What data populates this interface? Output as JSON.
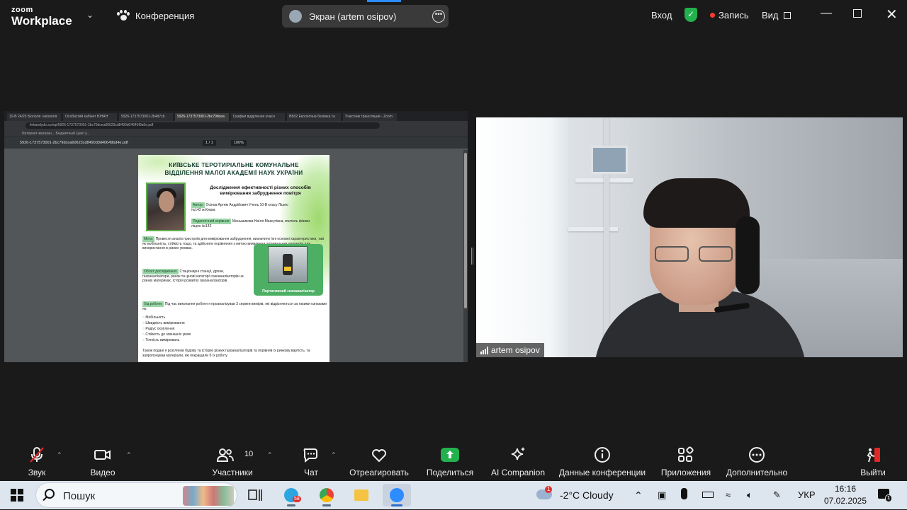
{
  "app": {
    "brand_line1": "zoom",
    "brand_line2": "Workplace",
    "conference_label": "Конференция",
    "screen_share_label": "Экран (artem osipov)",
    "signin_label": "Вход",
    "record_label": "Запись",
    "view_label": "Вид"
  },
  "shared_screen": {
    "tabs": [
      "10-В 24/25 Біологія і екологія",
      "Особистий кабінет ЮНАН",
      "5926-1737573001-2b4d7cb",
      "5926-1737573001-2bc79dcea",
      "Графіки відділення учасн",
      "ВБ02 Екологічна безпека та",
      "Участник трансляции - Zoom"
    ],
    "url": "liekandydo.su/wp/5926-1737573001-2bc79dcea60623cd8490d04640f9a6e.pdf",
    "bookmarks": "Интернет-магазин...   Бюджетный Цикл у...",
    "pdf_name": "5926-1737573001-2bc79dcea60623cd8490d0d40649bd4e.pdf",
    "page_indicator": "1 / 1",
    "zoom_level": "100%",
    "poster": {
      "title_line1": "КИЇВСЬКЕ ТЕРОТИРІАЛЬНЕ КОМУНАЛЬНЕ",
      "title_line2": "ВІДДІЛЕННЯ МАЛОЇ АКАДЕМІЇ НАУК УКРАЇНИ",
      "subtitle": "Дослідження ефективності різних способів вимірювання забруднення повітря",
      "author_tag": "Автор:",
      "author_text": "Осіпов Артем Андрійович Учень 10-В класу Ліцею №142 м.Києва",
      "advisor_tag": "Педагогічний керівник:",
      "advisor_text": "Меньшикова Наїля Максутівна, вчитель фізики ліцею №142",
      "goal_tag": "Мета:",
      "goal_text": "Провести аналіз пристроїв для вимірювання забруднення, визначити їхні основні характеристики, такі як мобільність, стійкість тощо, та здійснити порівняння з метою виявлення оптимальних варіантів для використання в різних умовах.",
      "object_tag": "Об'єкт дослідження:",
      "object_text": "Стаціонарні станції, дрони, газоаналізатори, ринок та ціновї категорії газоаналізаторів на різних материках, історія розвитку газоаналізаторів.",
      "gas_caption": "Портативний газоаналізатор",
      "process_tag": "Хід роботи:",
      "process_text": "Під час виконання роботи я проаналізував 3 сервеи вимірів, які відрізняються за такими ознаками як:",
      "list": [
        "Мобільність",
        "Швидкість вимірювання",
        "Радіус охоплення",
        "Стійкість до зовнішніх умов",
        "Точність вимірювань"
      ],
      "footer_text": "Також подані я розглянув будову та історію різних газоаналізаторів та порівняв їх ринкову вартість, та запропонував матеріали, які покращили б їх роботу"
    }
  },
  "video": {
    "participant_name": "artem osipov"
  },
  "toolbar": {
    "audio": "Звук",
    "video": "Видео",
    "participants": "Участники",
    "participants_count": "10",
    "chat": "Чат",
    "react": "Отреагировать",
    "share": "Поделиться",
    "ai": "AI Companion",
    "info": "Данные конференции",
    "apps": "Приложения",
    "more": "Дополнительно",
    "leave": "Выйти"
  },
  "taskbar": {
    "search_placeholder": "Пошук",
    "telegram_badge": "58",
    "weather_badge": "1",
    "weather": "-2°C  Cloudy",
    "language": "УКР",
    "time": "16:16",
    "date": "07.02.2025",
    "notif_count": "1"
  },
  "colors": {
    "zoom_dark": "#1a1a1a",
    "share_green": "#22b14c",
    "record_red": "#ff3b30",
    "accent_blue": "#2d8cff"
  }
}
